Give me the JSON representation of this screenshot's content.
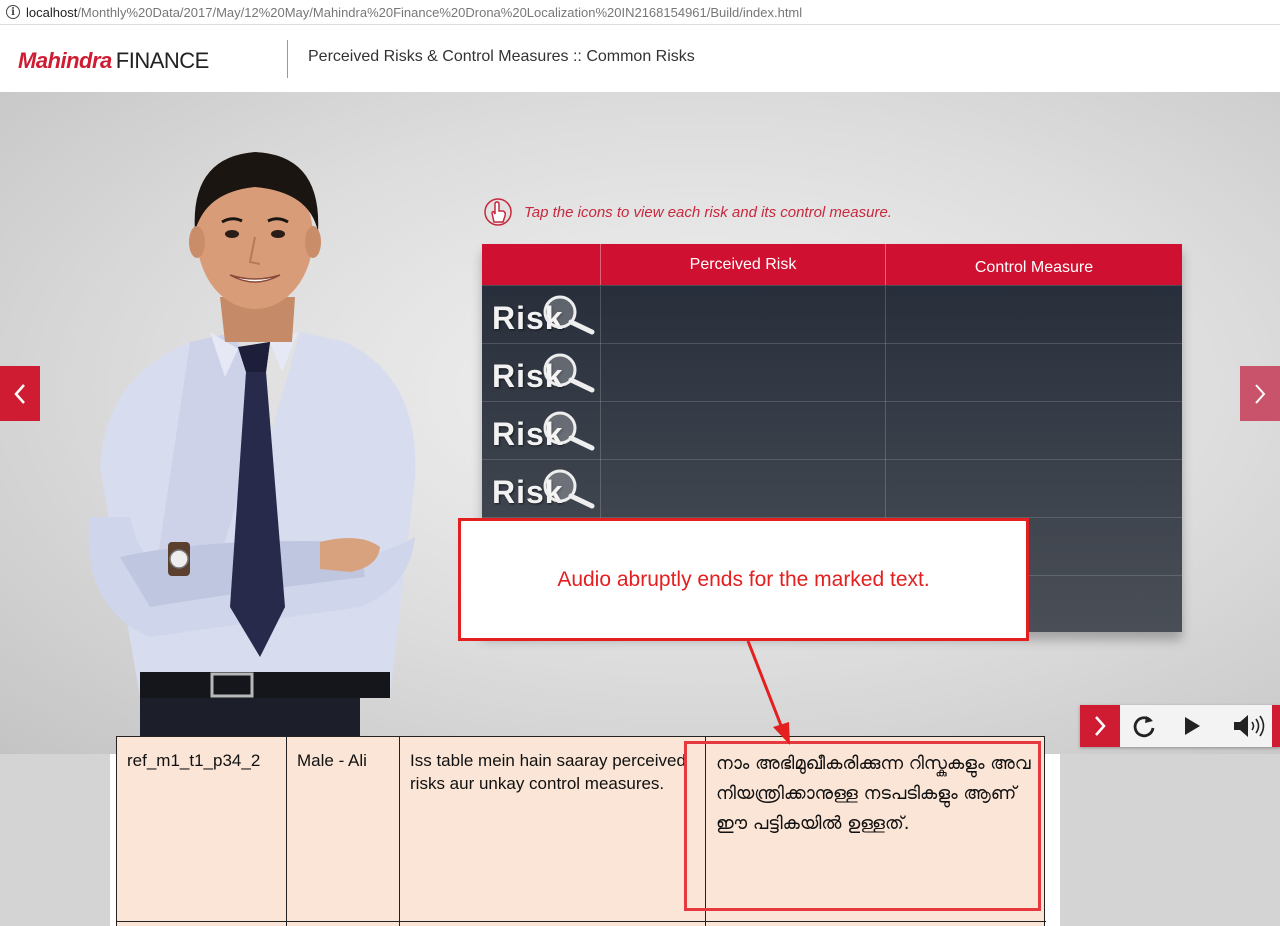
{
  "address_bar": {
    "host": "localhost",
    "path": "/Monthly%20Data/2017/May/12%20May/Mahindra%20Finance%20Drona%20Localization%20IN2168154961/Build/index.html"
  },
  "header": {
    "logo_brand": "Mahindra",
    "logo_finance": "FINANCE",
    "title": "Perceived Risks & Control Measures :: Common Risks"
  },
  "instruction": "Tap the icons to view each risk and its control measure.",
  "risk_table": {
    "columns": [
      "Perceived Risk",
      "Control Measure"
    ],
    "rows": [
      {
        "icon_label": "Risk"
      },
      {
        "icon_label": "Risk"
      },
      {
        "icon_label": "Risk"
      },
      {
        "icon_label": "Risk"
      }
    ]
  },
  "callout": "Audio abruptly ends for the marked text.",
  "script_row": {
    "ref": "ref_m1_t1_p34_2",
    "speaker": "Male - Ali",
    "source_text": "Iss table mein hain saaray perceived risks aur unkay control measures.",
    "translation": "നാം അഭിമുഖീകരിക്കുന്ന റിസ്കുകളും അവ നിയന്ത്രിക്കാനുള്ള നടപടികളും ആണ് ഈ പട്ടികയിൽ ഉള്ളത്."
  },
  "colors": {
    "brand_red": "#d01c32",
    "table_header_red": "#d01030",
    "callout_red": "#e31f1f",
    "doc_cell_bg": "#fbe5d6"
  }
}
